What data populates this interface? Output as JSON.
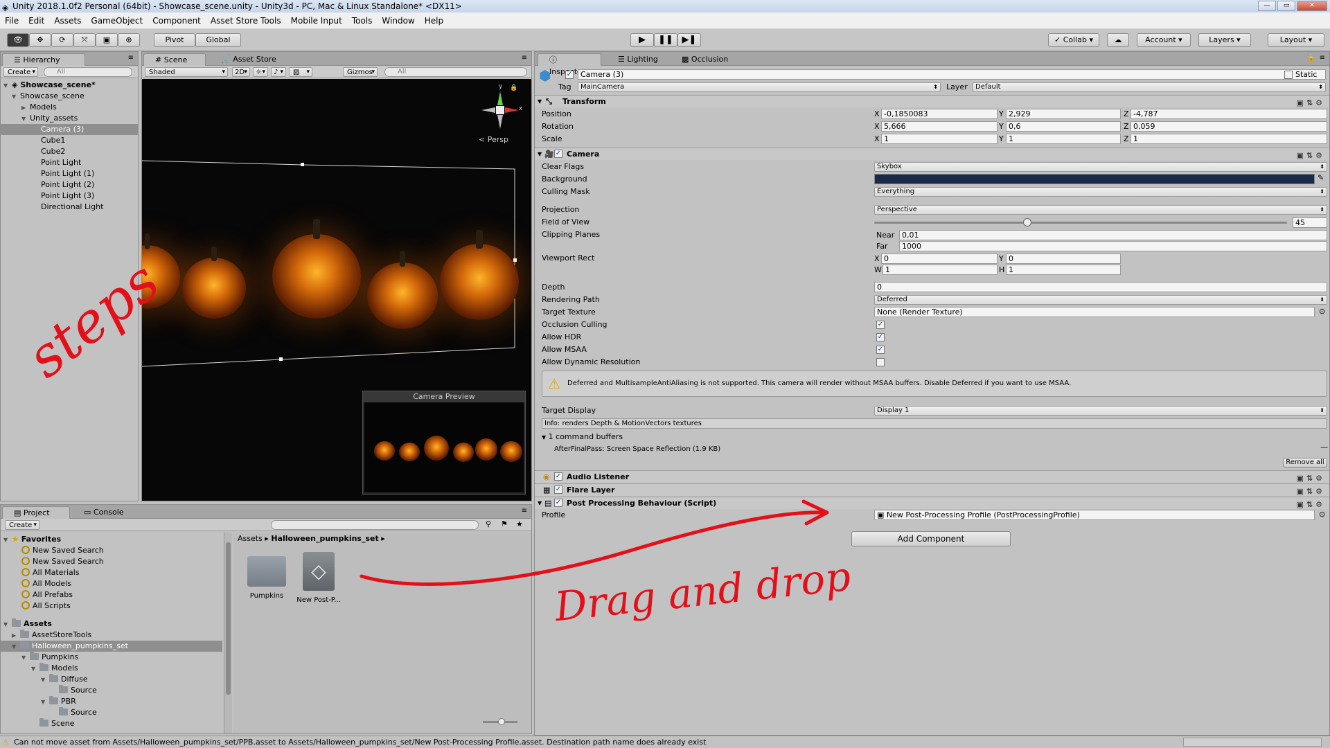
{
  "window": {
    "title": "Unity 2018.1.0f2 Personal (64bit) - Showcase_scene.unity - Unity3d - PC, Mac & Linux Standalone* <DX11>"
  },
  "menu": [
    "File",
    "Edit",
    "Assets",
    "GameObject",
    "Component",
    "Asset Store Tools",
    "Mobile Input",
    "Tools",
    "Window",
    "Help"
  ],
  "toolbar": {
    "pivot": "Pivot",
    "global": "Global",
    "collab": "Collab",
    "account": "Account",
    "layers": "Layers",
    "layout": "Layout"
  },
  "hierarchy": {
    "tab": "Hierarchy",
    "create": "Create",
    "search_placeholder": "All",
    "scene": "Showcase_scene*",
    "items": [
      {
        "label": "Showcase_scene"
      },
      {
        "label": "Models"
      },
      {
        "label": "Unity_assets"
      },
      {
        "label": "Camera (3)"
      },
      {
        "label": "Cube1"
      },
      {
        "label": "Cube2"
      },
      {
        "label": "Point Light"
      },
      {
        "label": "Point Light (1)"
      },
      {
        "label": "Point Light (2)"
      },
      {
        "label": "Point Light (3)"
      },
      {
        "label": "Directional Light"
      }
    ]
  },
  "scene": {
    "tabs": [
      "Scene",
      "Asset Store"
    ],
    "shading": "Shaded",
    "mode2d": "2D",
    "gizmos": "Gizmos",
    "search_placeholder": "All",
    "persp": "Persp",
    "axis_y": "y",
    "axis_x": "x",
    "camera_preview": "Camera Preview"
  },
  "project": {
    "tabs": [
      "Project",
      "Console"
    ],
    "create": "Create",
    "favorites_label": "Favorites",
    "favorites": [
      "New Saved Search",
      "New Saved Search",
      "All Materials",
      "All Models",
      "All Prefabs",
      "All Scripts"
    ],
    "assets_label": "Assets",
    "assets": [
      "AssetStoreTools",
      "Halloween_pumpkins_set",
      "Pumpkins",
      "Models",
      "Diffuse",
      "Source",
      "PBR",
      "Source",
      "Scene"
    ],
    "breadcrumb": [
      "Assets",
      "Halloween_pumpkins_set"
    ],
    "grid": [
      {
        "label": "Pumpkins"
      },
      {
        "label": "New Post-P..."
      }
    ]
  },
  "inspector": {
    "tabs": [
      "Inspector",
      "Lighting",
      "Occlusion"
    ],
    "object_name": "Camera (3)",
    "static_label": "Static",
    "tag_label": "Tag",
    "tag": "MainCamera",
    "layer_label": "Layer",
    "layer": "Default",
    "transform": {
      "title": "Transform",
      "position": {
        "label": "Position",
        "x": "-0,1850083",
        "y": "2,929",
        "z": "-4,787"
      },
      "rotation": {
        "label": "Rotation",
        "x": "5,666",
        "y": "0,6",
        "z": "0,059"
      },
      "scale": {
        "label": "Scale",
        "x": "1",
        "y": "1",
        "z": "1"
      }
    },
    "camera": {
      "title": "Camera",
      "clear_flags_label": "Clear Flags",
      "clear_flags": "Skybox",
      "background_label": "Background",
      "background_color": "#1b2a4a",
      "culling_mask_label": "Culling Mask",
      "culling_mask": "Everything",
      "projection_label": "Projection",
      "projection": "Perspective",
      "fov_label": "Field of View",
      "fov": "45",
      "fov_fraction": 0.37,
      "clipping_label": "Clipping Planes",
      "near_label": "Near",
      "near": "0,01",
      "far_label": "Far",
      "far": "1000",
      "viewport_label": "Viewport Rect",
      "vx": "0",
      "vy": "0",
      "vw": "1",
      "vh": "1",
      "depth_label": "Depth",
      "depth": "0",
      "rendering_path_label": "Rendering Path",
      "rendering_path": "Deferred",
      "target_texture_label": "Target Texture",
      "target_texture": "None (Render Texture)",
      "occlusion_label": "Occlusion Culling",
      "hdr_label": "Allow HDR",
      "msaa_label": "Allow MSAA",
      "dynres_label": "Allow Dynamic Resolution",
      "warning": "Deferred and MultisampleAntiAliasing is not supported. This camera will render without MSAA buffers. Disable Deferred if you want to use MSAA.",
      "target_display_label": "Target Display",
      "target_display": "Display 1",
      "info": "Info: renders Depth & MotionVectors textures",
      "command_buffers": "1 command buffers",
      "afterfinal": "AfterFinalPass: Screen Space Reflection (1.9 KB)",
      "remove_all": "Remove all"
    },
    "audio_listener": "Audio Listener",
    "flare_layer": "Flare Layer",
    "ppb": {
      "title": "Post Processing Behaviour (Script)",
      "profile_label": "Profile",
      "profile": "New Post-Processing Profile (PostProcessingProfile)"
    },
    "add_component": "Add Component"
  },
  "annotations": {
    "steps": "steps",
    "drag": "Drag and drop"
  },
  "status": "Can not move asset from Assets/Halloween_pumpkins_set/PPB.asset to Assets/Halloween_pumpkins_set/New Post-Processing Profile.asset. Destination path name does already exist"
}
